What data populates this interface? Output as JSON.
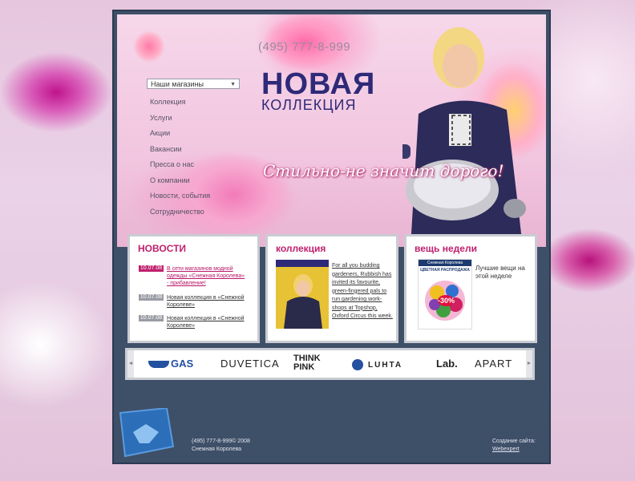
{
  "header": {
    "phone": "(495) 777-8-999",
    "title_line1": "НОВАЯ",
    "title_line2": "КОЛЛЕКЦИЯ",
    "slogan": "Стильно-не значит дорого!"
  },
  "nav": {
    "stores_select": "Наши магазины",
    "items": [
      "Коллекция",
      "Услуги",
      "Акции",
      "Вакансии",
      "Пресса о нас",
      "О компании",
      "Новости, события",
      "Сотрудничество"
    ]
  },
  "news": {
    "heading": "НОВОСТИ",
    "items": [
      {
        "date": "10.07.08",
        "text": "В сети магазинов модной одежды «Снежная Королева» - прибавление!"
      },
      {
        "date": "10.07.08",
        "text": "Новая коллекция в «Снежной Королеве»"
      },
      {
        "date": "10.07.08",
        "text": "Новая коллекция в «Снежной Королеве»"
      }
    ]
  },
  "collection": {
    "heading": "коллекция",
    "text": "For all you budding gardeners, Rubbish has invited its favourite, green-fingered pals to run gardening work-shops at Topshop, Oxford Circus this week."
  },
  "week_item": {
    "heading": "вещь недели",
    "caption": "Лучшие вещи на этой неделе",
    "image_brand": "Снежная Королева",
    "image_sale": "ЦВЕТНАЯ РАСПРОДАЖА",
    "image_discount": "-30%"
  },
  "brands": [
    "GAS",
    "DUVETICA",
    "THINK PINK",
    "LUHTA",
    "Lab.",
    "APART"
  ],
  "footer": {
    "copyright": "(495) 777-8-999© 2008",
    "company": "Снежная Королева",
    "credit_label": "Создание сайта:",
    "credit_link": "Webexpert"
  },
  "colors": {
    "accent": "#c0206e",
    "frame": "#3e4f68",
    "title": "#2e2a78"
  }
}
